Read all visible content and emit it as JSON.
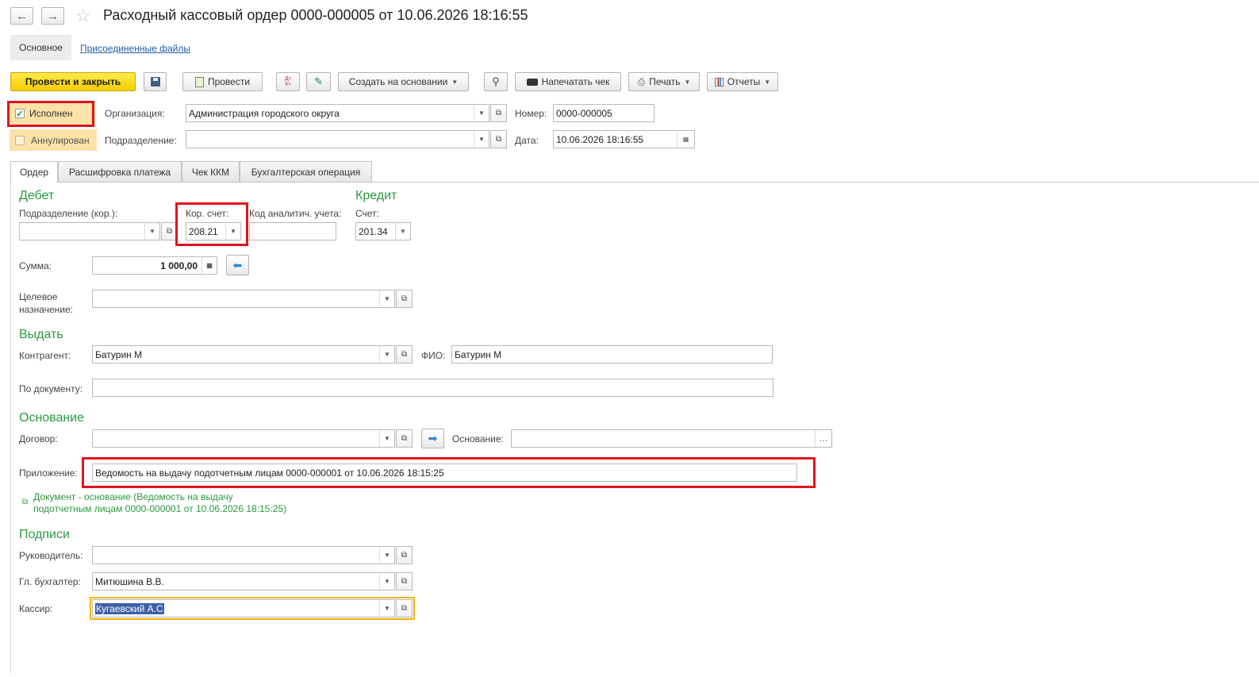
{
  "window": {
    "back_icon": "arrow-left-icon",
    "forward_icon": "arrow-right-icon",
    "star_icon": "star-icon",
    "title": "Расходный кассовый ордер 0000-000005 от 10.06.2026 18:16:55"
  },
  "nav": {
    "main": "Основное",
    "files": "Присоединенные файлы"
  },
  "toolbar": {
    "post_close": "Провести и закрыть",
    "post": "Провести",
    "create_based": "Создать на основании",
    "print_receipt": "Напечатать чек",
    "print": "Печать",
    "reports": "Отчеты",
    "dtkt": "Дт Кт"
  },
  "header": {
    "executed_label": "Исполнен",
    "executed_checked": true,
    "annulled_label": "Аннулирован",
    "org_label": "Организация:",
    "org_value": "Администрация городского округа",
    "dept_label": "Подразделение:",
    "dept_value": "",
    "number_label": "Номер:",
    "number_value": "0000-000005",
    "date_label": "Дата:",
    "date_value": "10.06.2026 18:16:55"
  },
  "tabs": [
    "Ордер",
    "Расшифровка платежа",
    "Чек ККМ",
    "Бухгалтерская операция"
  ],
  "debit": {
    "title": "Дебет",
    "dept_label": "Подразделение (кор.):",
    "dept_value": "",
    "corr_label": "Кор. счет:",
    "corr_value": "208.21",
    "code_label": "Код аналитич. учета:",
    "code_value": ""
  },
  "credit": {
    "title": "Кредит",
    "account_label": "Счет:",
    "account_value": "201.34"
  },
  "sum": {
    "label": "Сумма:",
    "value": "1 000,00"
  },
  "purpose": {
    "label_line1": "Целевое",
    "label_line2": "назначение:",
    "value": ""
  },
  "issue": {
    "title": "Выдать",
    "counterparty_label": "Контрагент:",
    "counterparty_value": "Батурин М",
    "fio_label": "ФИО:",
    "fio_value": "Батурин М",
    "by_doc_label": "По документу:",
    "by_doc_value": ""
  },
  "basis": {
    "title": "Основание",
    "contract_label": "Договор:",
    "contract_value": "",
    "basis_label": "Основание:",
    "basis_value": "",
    "attachment_label": "Приложение:",
    "attachment_value": "Ведомость на выдачу подотчетным лицам 0000-000001 от 10.06.2026 18:15:25",
    "doc_link_line1": "Документ - основание (Ведомость на выдачу",
    "doc_link_line2": "подотчетным лицам 0000-000001 от 10.06.2026 18:15:25)"
  },
  "signatures": {
    "title": "Подписи",
    "head_label": "Руководитель:",
    "head_value": "",
    "chief_acc_label": "Гл. бухгалтер:",
    "chief_acc_value": "Митюшина В.В.",
    "cashier_label": "Кассир:",
    "cashier_value": "Кугаевский А.С"
  },
  "colors": {
    "section": "#2a9a3e",
    "highlight_box": "#e0141e",
    "primary_button": "#f3cd00",
    "focus": "#f0b400"
  }
}
